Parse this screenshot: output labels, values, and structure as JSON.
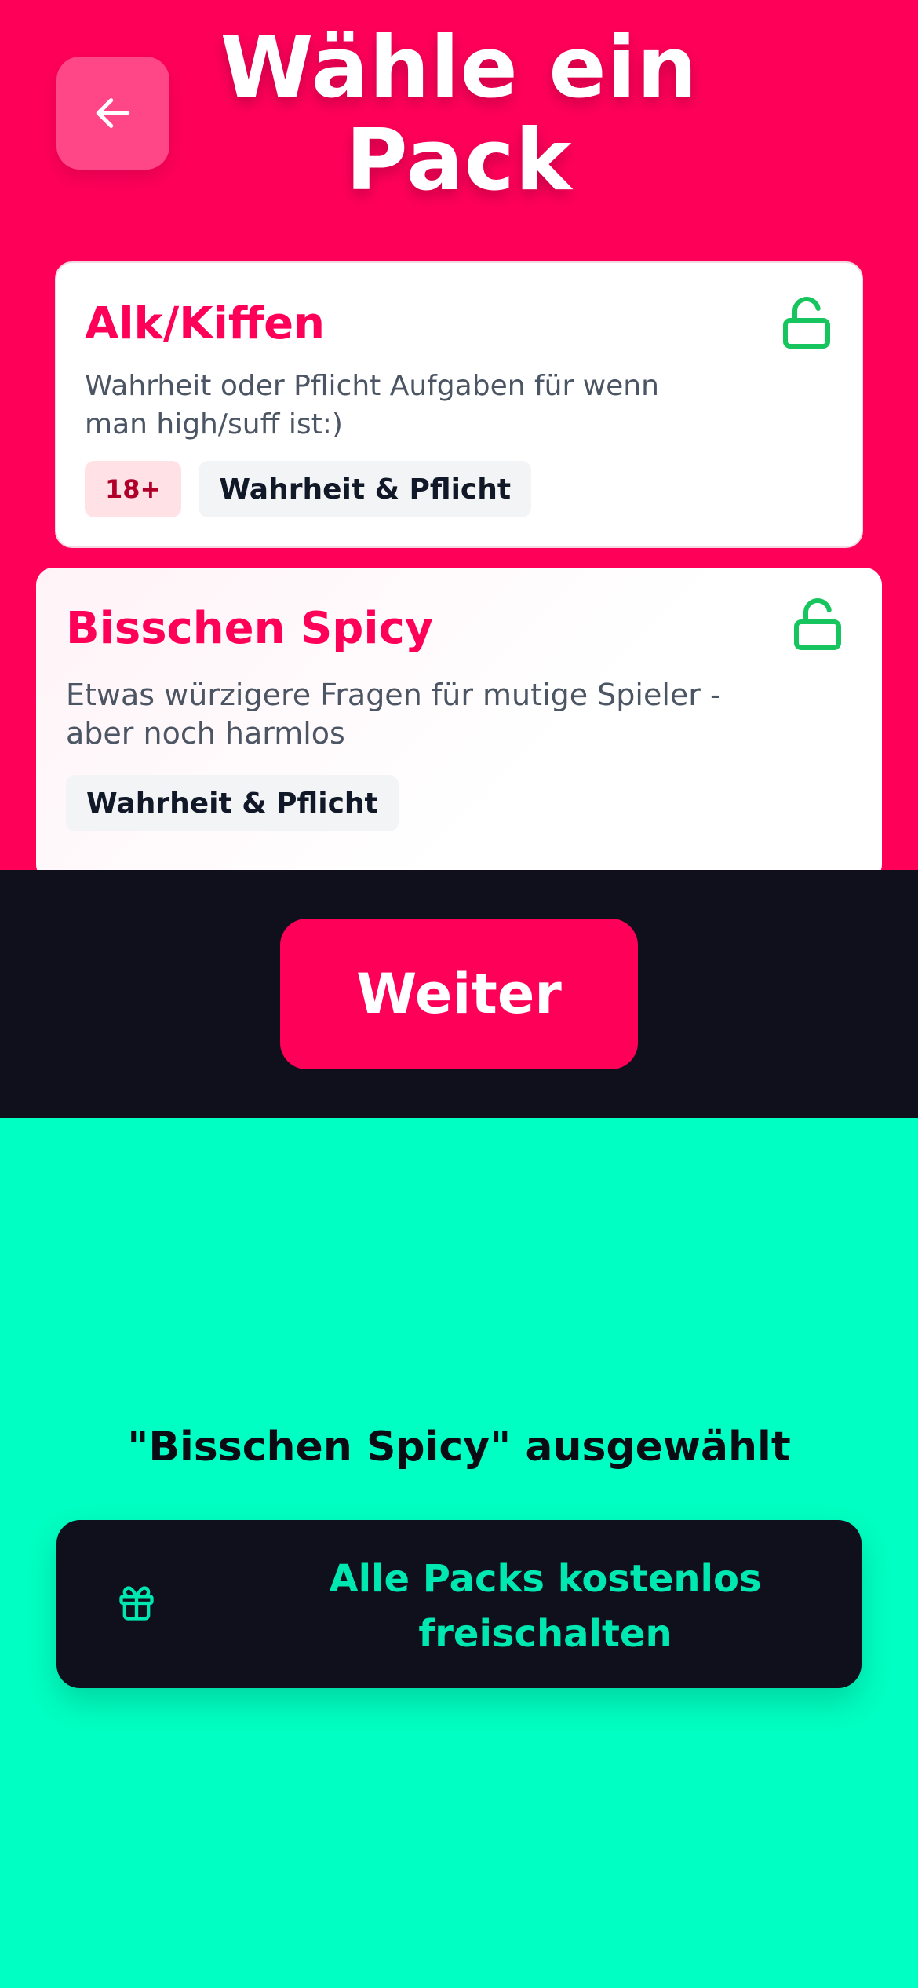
{
  "header": {
    "title": "Wähle ein Pack"
  },
  "packs": [
    {
      "title": "Alk/Kiffen",
      "description": "Wahrheit oder Pflicht Aufgaben für wenn man high/suff ist:)",
      "tags": [
        "18+",
        "Wahrheit & Pflicht"
      ],
      "lock_icon": "unlocked-padlock-icon"
    },
    {
      "title": "Bisschen Spicy",
      "description": "Etwas würzigere Fragen für mutige Spieler - aber noch harmlos",
      "tags": [
        "Wahrheit & Pflicht"
      ],
      "lock_icon": "unlocked-padlock-icon",
      "selected": true
    }
  ],
  "footer": {
    "next_label": "Weiter",
    "selected_text": "\"Bisschen Spicy\" ausgewählt",
    "unlock_label": "Alle Packs kostenlos freischalten",
    "unlock_icon": "gift-icon"
  },
  "colors": {
    "primary": "#FF0059",
    "dark": "#10101C",
    "mint": "#00FFC2",
    "lock_green": "#16C55E"
  }
}
